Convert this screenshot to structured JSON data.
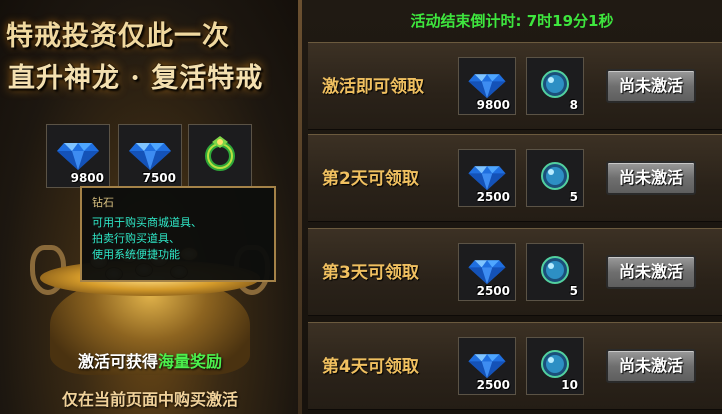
{
  "promo": {
    "title_line1": "特戒投资仅此一次",
    "title_line2": "直升神龙 · 复活特戒",
    "items": [
      {
        "icon": "diamond-icon",
        "qty": "9800"
      },
      {
        "icon": "diamond-icon",
        "qty": "7500"
      },
      {
        "icon": "green-ring-icon",
        "qty": ""
      }
    ],
    "tooltip": {
      "title": "钻石",
      "lines": [
        "可用于购买商城道具、",
        "拍卖行购买道具、",
        "使用系统便捷功能"
      ]
    },
    "bottom_text": "激活可获得",
    "bottom_highlight": "海量奖励",
    "footer_text": "仅在当前页面中购买激活"
  },
  "countdown": {
    "label": "活动结束倒计时:",
    "value": "7时19分1秒"
  },
  "rewards": [
    {
      "label": "激活即可领取",
      "diamond_qty": "9800",
      "orb_qty": "8",
      "button": "尚未激活"
    },
    {
      "label": "第2天可领取",
      "diamond_qty": "2500",
      "orb_qty": "5",
      "button": "尚未激活"
    },
    {
      "label": "第3天可领取",
      "diamond_qty": "2500",
      "orb_qty": "5",
      "button": "尚未激活"
    },
    {
      "label": "第4天可领取",
      "diamond_qty": "2500",
      "orb_qty": "10",
      "button": "尚未激活"
    }
  ],
  "colors": {
    "accent_green": "#3ee63e",
    "gold_text": "#f0c060",
    "tooltip_cyan": "#2fe8c8"
  }
}
